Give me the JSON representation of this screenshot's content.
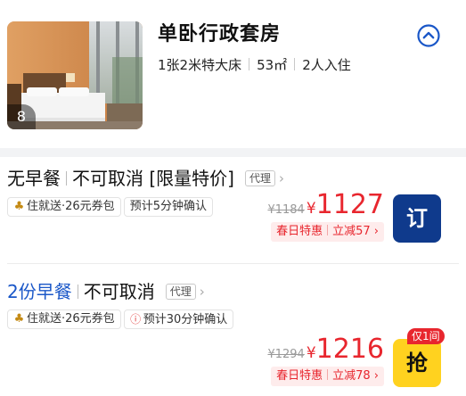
{
  "room": {
    "title": "单卧行政套房",
    "photo_count": "8",
    "bed": "1张2米特大床",
    "area": "53㎡",
    "guests": "2人入住",
    "collapse_icon": "chevron-up-circle-icon"
  },
  "rates": [
    {
      "meal": "无早餐",
      "cancel": "不可取消",
      "special": "[限量特价]",
      "agent_label": "代理",
      "tags": [
        "住就送·26元券包",
        "预计5分钟确认"
      ],
      "original_price": "¥1184",
      "currency": "¥",
      "price": "1127",
      "promo_label": "春日特惠",
      "promo_discount": "立减57",
      "button_label": "订",
      "button_color": "#0f3a8c"
    },
    {
      "meal": "2份早餐",
      "cancel": "不可取消",
      "agent_label": "代理",
      "tags": [
        "住就送·26元券包",
        "预计30分钟确认"
      ],
      "original_price": "¥1294",
      "currency": "¥",
      "price": "1216",
      "promo_label": "春日特惠",
      "promo_discount": "立减78",
      "button_label": "抢",
      "button_color": "#ffd21f",
      "badge": "仅1间"
    }
  ],
  "colors": {
    "price_red": "#e8262e",
    "meal_blue": "#1a57c8"
  }
}
